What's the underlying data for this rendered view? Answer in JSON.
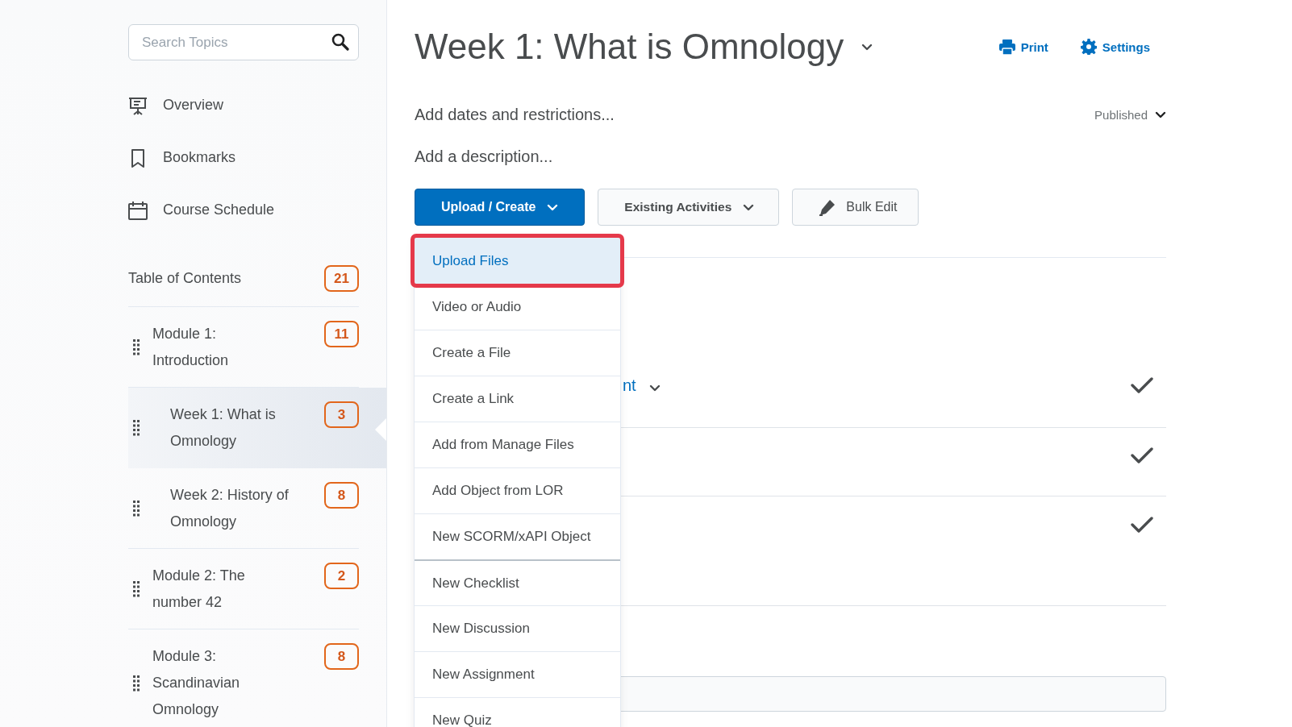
{
  "sidebar": {
    "search": {
      "placeholder": "Search Topics"
    },
    "nav": [
      {
        "kind": "overview",
        "label": "Overview"
      },
      {
        "kind": "bookmarks",
        "label": "Bookmarks"
      },
      {
        "kind": "schedule",
        "label": "Course Schedule"
      }
    ],
    "toc": {
      "label": "Table of Contents",
      "count": "21"
    },
    "modules": [
      {
        "title": "Module 1: Introduction",
        "count": "11",
        "selected": false,
        "children": [
          {
            "title": "Week 1: What is Omnology",
            "count": "3",
            "selected": true
          },
          {
            "title": "Week 2: History of Omnology",
            "count": "8",
            "selected": false
          }
        ]
      },
      {
        "title": "Module 2: The number 42",
        "count": "2",
        "selected": false
      },
      {
        "title": "Module 3: Scandinavian Omnology",
        "count": "8",
        "selected": false
      }
    ]
  },
  "header": {
    "title": "Week 1: What is Omnology",
    "actions": [
      {
        "kind": "print",
        "label": "Print"
      },
      {
        "kind": "settings",
        "label": "Settings"
      }
    ]
  },
  "dates_link": "Add dates and restrictions...",
  "status": "Published",
  "description_link": "Add a description...",
  "toolbar": [
    {
      "kind": "primary",
      "label": "Upload / Create"
    },
    {
      "kind": "secondary",
      "label": "Existing Activities"
    },
    {
      "kind": "bulk",
      "label": "Bulk Edit"
    }
  ],
  "menu": {
    "items": [
      {
        "label": "Upload Files",
        "selected": true,
        "annotated": true,
        "separator_before": false
      },
      {
        "label": "Video or Audio",
        "selected": false,
        "annotated": false,
        "separator_before": false
      },
      {
        "label": "Create a File",
        "selected": false,
        "annotated": false,
        "separator_before": false
      },
      {
        "label": "Create a Link",
        "selected": false,
        "annotated": false,
        "separator_before": false
      },
      {
        "label": "Add from Manage Files",
        "selected": false,
        "annotated": false,
        "separator_before": false
      },
      {
        "label": "Add Object from LOR",
        "selected": false,
        "annotated": false,
        "separator_before": false
      },
      {
        "label": "New SCORM/xAPI Object",
        "selected": false,
        "annotated": false,
        "separator_before": false
      },
      {
        "label": "New Checklist",
        "selected": false,
        "annotated": false,
        "separator_before": true
      },
      {
        "label": "New Discussion",
        "selected": false,
        "annotated": false,
        "separator_before": false
      },
      {
        "label": "New Assignment",
        "selected": false,
        "annotated": false,
        "separator_before": false
      },
      {
        "label": "New Quiz",
        "selected": false,
        "annotated": false,
        "separator_before": false
      }
    ]
  },
  "content_rows": [
    {
      "link": "nt",
      "checked": true
    },
    {
      "checked": true
    },
    {
      "checked": true
    }
  ]
}
